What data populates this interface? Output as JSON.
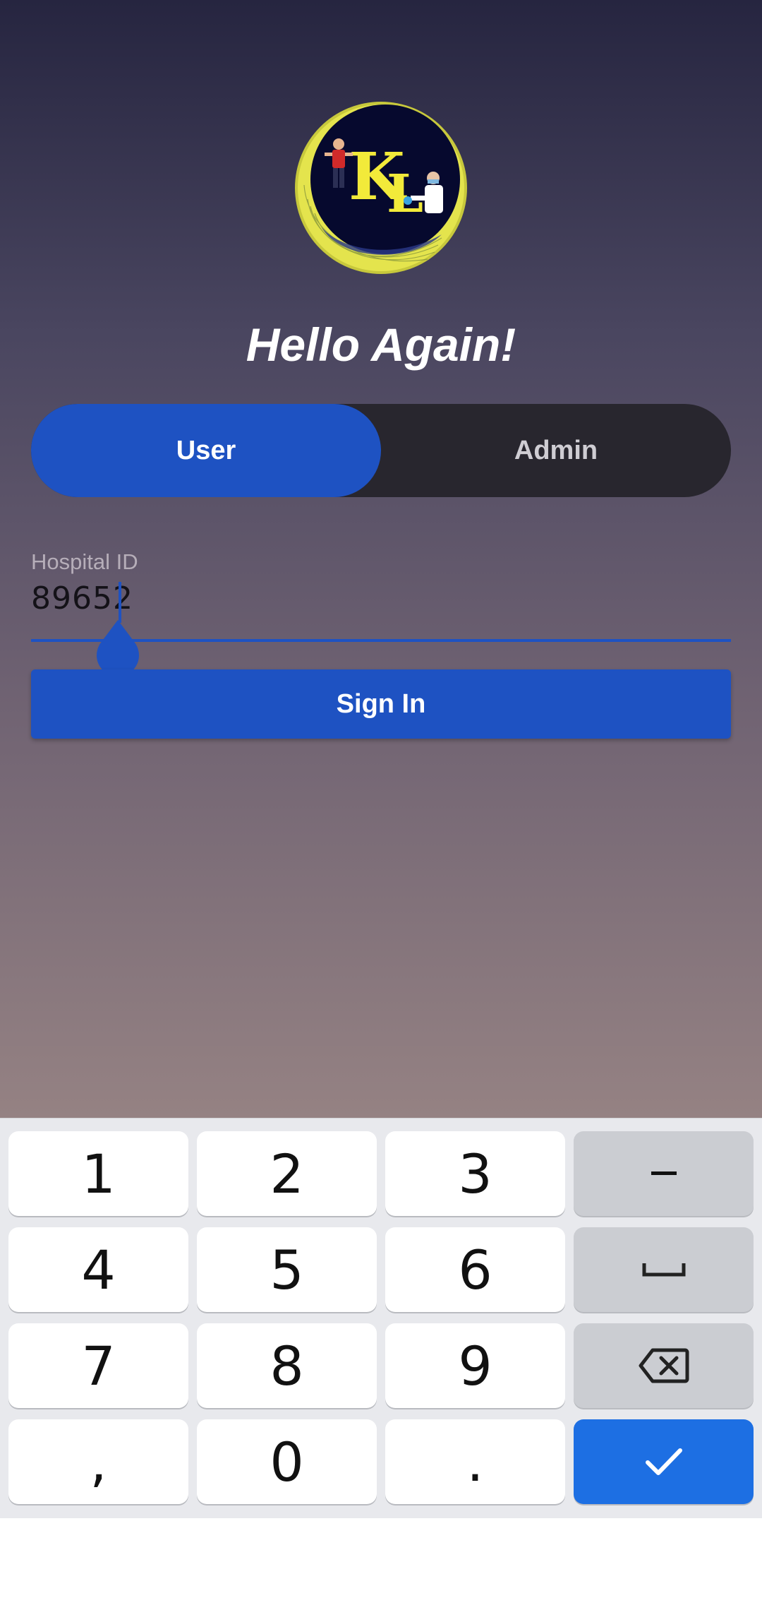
{
  "screen": {
    "greeting": "Hello Again!",
    "logo_text": "KL",
    "tabs": [
      {
        "label": "User",
        "selected": true
      },
      {
        "label": "Admin",
        "selected": false
      }
    ],
    "hospital_id": {
      "label": "Hospital ID",
      "value": "89652"
    },
    "sign_in_label": "Sign In"
  },
  "keyboard": {
    "row1": [
      "1",
      "2",
      "3"
    ],
    "row2": [
      "4",
      "5",
      "6"
    ],
    "row3": [
      "7",
      "8",
      "9"
    ],
    "row4": [
      ",",
      "0",
      "."
    ],
    "fn_keys": [
      "minus-icon",
      "space-bar-icon",
      "backspace-icon",
      "check-icon"
    ]
  },
  "colors": {
    "accent": "#1e52c2",
    "keyboard_action": "#1d6fe3",
    "logo_ring": "#e8e84c",
    "logo_bg": "#06092e"
  }
}
